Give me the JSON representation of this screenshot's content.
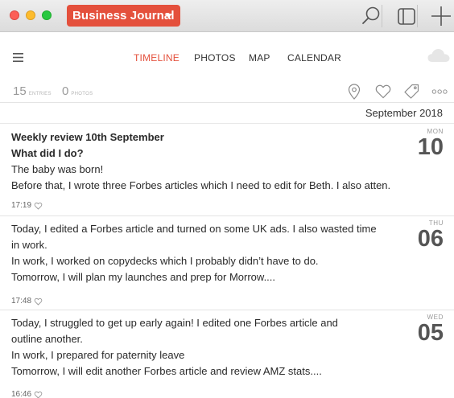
{
  "app": {
    "journal_name": "Business Journal"
  },
  "toolbar": {
    "search_icon": "search-icon",
    "sidebar_icon": "sidebar-toggle-icon",
    "add_icon": "plus-icon"
  },
  "nav": {
    "tabs": [
      {
        "label": "TIMELINE",
        "active": true
      },
      {
        "label": "PHOTOS",
        "active": false
      },
      {
        "label": "MAP",
        "active": false
      },
      {
        "label": "CALENDAR",
        "active": false
      }
    ]
  },
  "stats": {
    "entries_count": "15",
    "entries_label": "ENTRIES",
    "photos_count": "0",
    "photos_label": "PHOTOS"
  },
  "timeline": {
    "month_header": "September 2018",
    "entries": [
      {
        "lines": [
          "Weekly review 10th September",
          "What did I do?",
          "The baby was born!",
          "Before that, I wrote three Forbes articles which I need to edit for Beth. I also atten..."
        ],
        "bold_lines": 2,
        "time": "17:19",
        "weekday": "MON",
        "day": "10"
      },
      {
        "lines": [
          "Today,  I edited a Forbes article and turned on some UK ads. I also wasted time",
          "in work.",
          "In  work, I worked on copydecks which I probably didn’t have to do.",
          "Tomorrow, I will plan my launches and prep for Morrow...."
        ],
        "bold_lines": 0,
        "time": "17:48",
        "weekday": "THU",
        "day": "06"
      },
      {
        "lines": [
          "Today,  I struggled to get up early again! I edited one Forbes article and",
          "outline another.",
          "In  work, I prepared for paternity leave",
          "Tomorrow, I will edit another Forbes article and review AMZ stats...."
        ],
        "bold_lines": 0,
        "time": "16:46",
        "weekday": "WED",
        "day": "05"
      }
    ]
  },
  "colors": {
    "accent": "#e4503c",
    "close": "#fc5f57",
    "minimize": "#fdbc2e",
    "maximize": "#28c840"
  }
}
